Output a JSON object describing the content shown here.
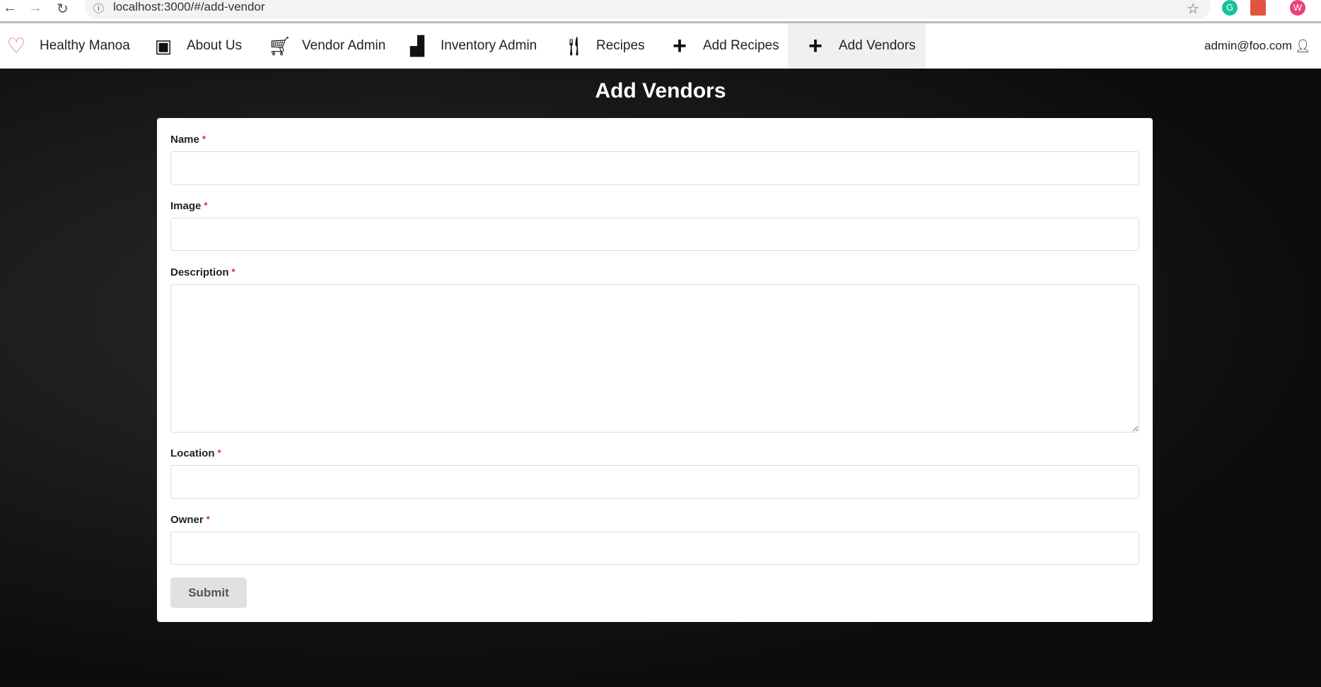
{
  "browser": {
    "url": "localhost:3000/#/add-vendor",
    "ext_grammarly": "G",
    "ext_profile": "W"
  },
  "nav": {
    "brand": "Healthy Manoa",
    "items": [
      {
        "label": "About Us",
        "icon": "id-card-icon"
      },
      {
        "label": "Vendor Admin",
        "icon": "cart-icon"
      },
      {
        "label": "Inventory Admin",
        "icon": "boxes-icon"
      },
      {
        "label": "Recipes",
        "icon": "utensils-icon"
      },
      {
        "label": "Add Recipes",
        "icon": "plus-icon"
      },
      {
        "label": "Add Vendors",
        "icon": "plus-icon"
      }
    ],
    "user": "admin@foo.com"
  },
  "page": {
    "title": "Add Vendors"
  },
  "form": {
    "required": "*",
    "fields": [
      {
        "label": "Name",
        "value": ""
      },
      {
        "label": "Image",
        "value": ""
      },
      {
        "label": "Description",
        "value": ""
      },
      {
        "label": "Location",
        "value": ""
      },
      {
        "label": "Owner",
        "value": ""
      }
    ],
    "submit": "Submit"
  }
}
